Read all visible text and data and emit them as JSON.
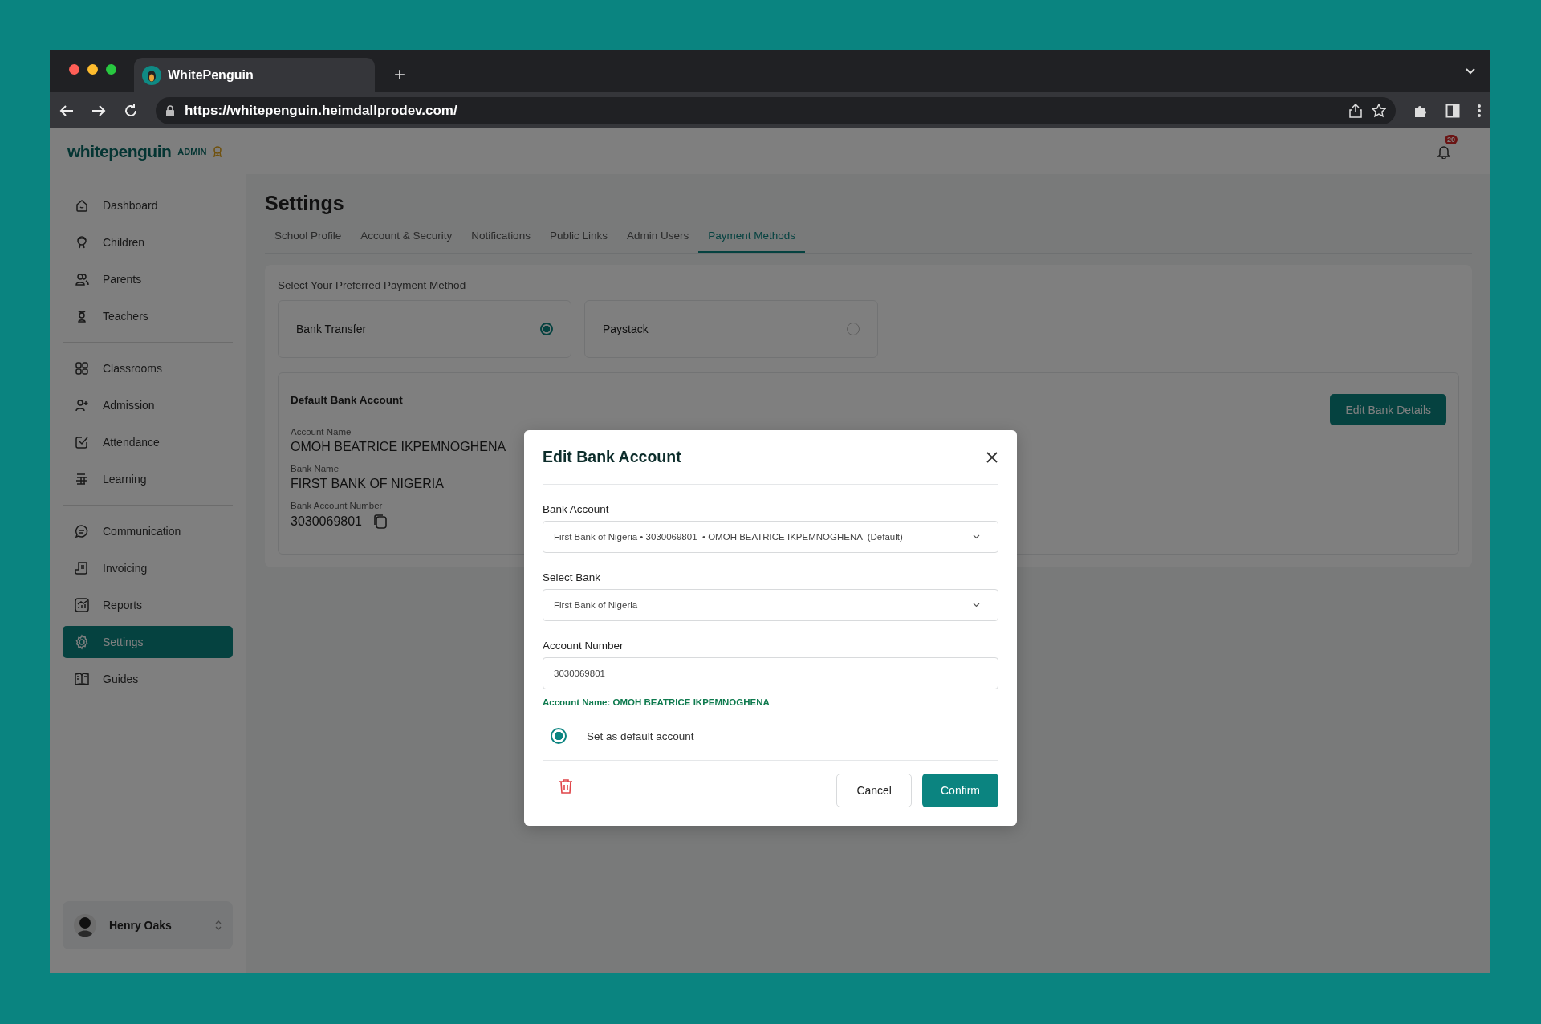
{
  "browser": {
    "tab_title": "WhitePenguin",
    "new_tab": "+",
    "url": "https://whitepenguin.heimdallprodev.com/"
  },
  "sidebar": {
    "logo": "whitepenguin",
    "role": "ADMIN",
    "groups": [
      [
        {
          "label": "Dashboard",
          "selected": false
        },
        {
          "label": "Children",
          "selected": false
        },
        {
          "label": "Parents",
          "selected": false
        },
        {
          "label": "Teachers",
          "selected": false
        }
      ],
      [
        {
          "label": "Classrooms",
          "selected": false
        },
        {
          "label": "Admission",
          "selected": false
        },
        {
          "label": "Attendance",
          "selected": false
        },
        {
          "label": "Learning",
          "selected": false
        }
      ],
      [
        {
          "label": "Communication",
          "selected": false
        },
        {
          "label": "Invoicing",
          "selected": false
        },
        {
          "label": "Reports",
          "selected": false
        },
        {
          "label": "Settings",
          "selected": true
        },
        {
          "label": "Guides",
          "selected": false
        }
      ]
    ],
    "user": {
      "name": "Henry Oaks"
    }
  },
  "header": {
    "notification_count": "20"
  },
  "settings": {
    "title": "Settings",
    "tabs": [
      {
        "label": "School Profile",
        "selected": false
      },
      {
        "label": "Account & Security",
        "selected": false
      },
      {
        "label": "Notifications",
        "selected": false
      },
      {
        "label": "Public Links",
        "selected": false
      },
      {
        "label": "Admin Users",
        "selected": false
      },
      {
        "label": "Payment Methods",
        "selected": true
      }
    ],
    "payment_prompt": "Select Your Preferred Payment Method",
    "methods": [
      {
        "label": "Bank Transfer",
        "selected": true
      },
      {
        "label": "Paystack",
        "selected": false
      }
    ],
    "default_account": {
      "title": "Default Bank Account",
      "fields": [
        {
          "kind": "plain",
          "label": "Account Name",
          "value": "OMOH BEATRICE IKPEMNOGHENA"
        },
        {
          "kind": "plain",
          "label": "Bank Name",
          "value": "FIRST BANK OF NIGERIA"
        },
        {
          "kind": "copyable",
          "label": "Bank Account Number",
          "value": "3030069801"
        }
      ],
      "edit_button": "Edit Bank Details"
    }
  },
  "modal": {
    "title": "Edit Bank Account",
    "fields": [
      {
        "kind": "select",
        "label": "Bank Account",
        "value": "First Bank of Nigeria • 3030069801  • OMOH BEATRICE IKPEMNOGHENA  (Default)"
      },
      {
        "kind": "select",
        "label": "Select Bank",
        "value": "First Bank of Nigeria"
      },
      {
        "kind": "input",
        "label": "Account Number",
        "value": "3030069801"
      }
    ],
    "account_name_note": "Account Name: OMOH BEATRICE IKPEMNOGHENA",
    "default_option": {
      "label": "Set as default account",
      "selected": true
    },
    "cancel_button": "Cancel",
    "confirm_button": "Confirm"
  }
}
